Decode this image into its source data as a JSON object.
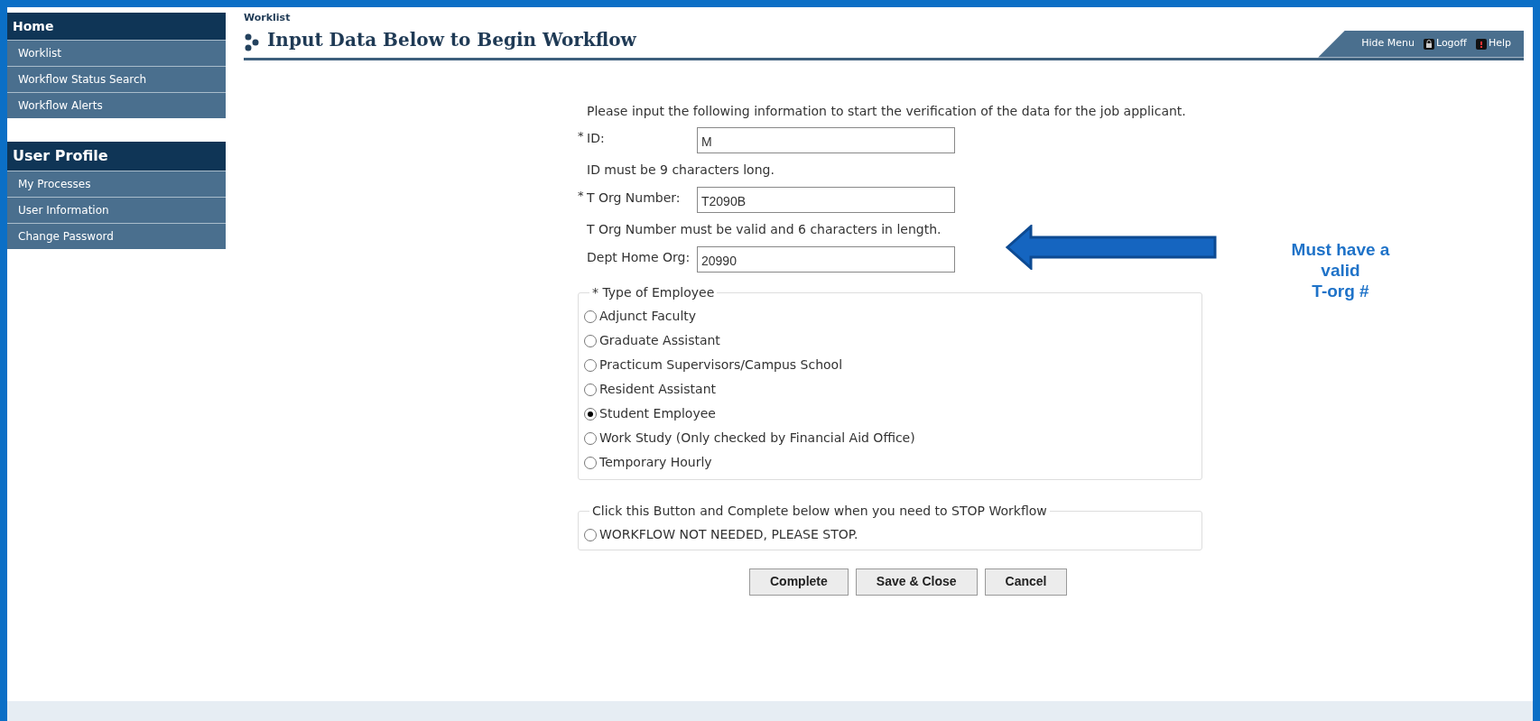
{
  "sidebar": {
    "sections": [
      {
        "title": "Home",
        "items": [
          {
            "label": "Worklist"
          },
          {
            "label": "Workflow Status Search"
          },
          {
            "label": "Workflow Alerts"
          }
        ]
      },
      {
        "title": "User Profile",
        "items": [
          {
            "label": "My Processes"
          },
          {
            "label": "User Information"
          },
          {
            "label": "Change Password"
          }
        ]
      }
    ]
  },
  "breadcrumb": "Worklist",
  "page_title": "Input Data Below to Begin Workflow",
  "header_links": [
    {
      "label": "Hide Menu",
      "kind": "text"
    },
    {
      "label": "Logoff",
      "kind": "lock"
    },
    {
      "label": "Help",
      "kind": "help"
    }
  ],
  "form": {
    "intro": "Please input the following information to start the verification of the data for the job applicant.",
    "fields": [
      {
        "mark": "*",
        "label": "ID:",
        "value": "M",
        "hint": "ID must be 9 characters long."
      },
      {
        "mark": "*",
        "label": "T Org Number:",
        "value": "T2090B",
        "hint": "T Org Number must be valid and 6 characters in length."
      },
      {
        "label": "Dept Home Org:",
        "value": "20990"
      }
    ],
    "employee_type": {
      "legend": "* Type of Employee",
      "options": [
        {
          "label": "Adjunct Faculty",
          "selected": false
        },
        {
          "label": "Graduate Assistant",
          "selected": false
        },
        {
          "label": "Practicum Supervisors/Campus School",
          "selected": false
        },
        {
          "label": "Resident Assistant",
          "selected": false
        },
        {
          "label": "Student Employee",
          "selected": true
        },
        {
          "label": "Work Study (Only checked by Financial Aid Office)",
          "selected": false
        },
        {
          "label": "Temporary Hourly",
          "selected": false
        }
      ]
    },
    "stop": {
      "legend": "Click this Button and Complete below when you need to STOP Workflow",
      "options": [
        {
          "label": "WORKFLOW NOT NEEDED, PLEASE STOP.",
          "selected": false
        }
      ]
    },
    "buttons": [
      "Complete",
      "Save & Close",
      "Cancel"
    ]
  },
  "callout": {
    "text": "Must have a\nvalid\nT-org #"
  }
}
